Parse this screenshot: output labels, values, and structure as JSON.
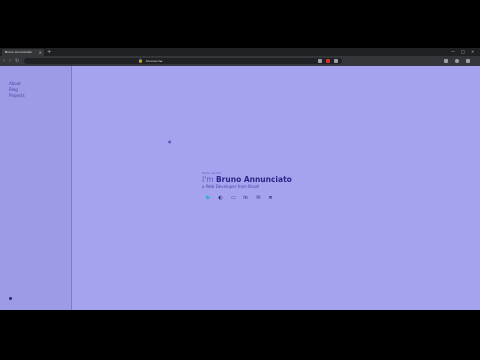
{
  "browser": {
    "tab_title": "Bruno Annunciato",
    "tab_close": "×",
    "new_tab": "+",
    "window_controls": [
      "—",
      "□",
      "×"
    ],
    "url": "brunoa.me"
  },
  "nav": {
    "items": [
      {
        "label": "About"
      },
      {
        "label": "Blog"
      },
      {
        "label": "Projects"
      }
    ]
  },
  "hero": {
    "greeting": "Hello, world!",
    "intro": "I'm ",
    "name": "Bruno Annunciato",
    "subtitle": "a Web Developer from Brazil"
  },
  "socials": [
    {
      "icon": "twitter-icon",
      "glyph": "🐦"
    },
    {
      "icon": "github-icon",
      "glyph": "◐"
    },
    {
      "icon": "dev-icon",
      "glyph": "▭"
    },
    {
      "icon": "linkedin-icon",
      "glyph": "in"
    },
    {
      "icon": "email-icon",
      "glyph": "✉"
    },
    {
      "icon": "stackoverflow-icon",
      "glyph": "≣"
    }
  ],
  "colors": {
    "page_bg": "#a6a3ee",
    "sidebar_bg": "#9d9ae6",
    "accent": "#2a2485"
  }
}
